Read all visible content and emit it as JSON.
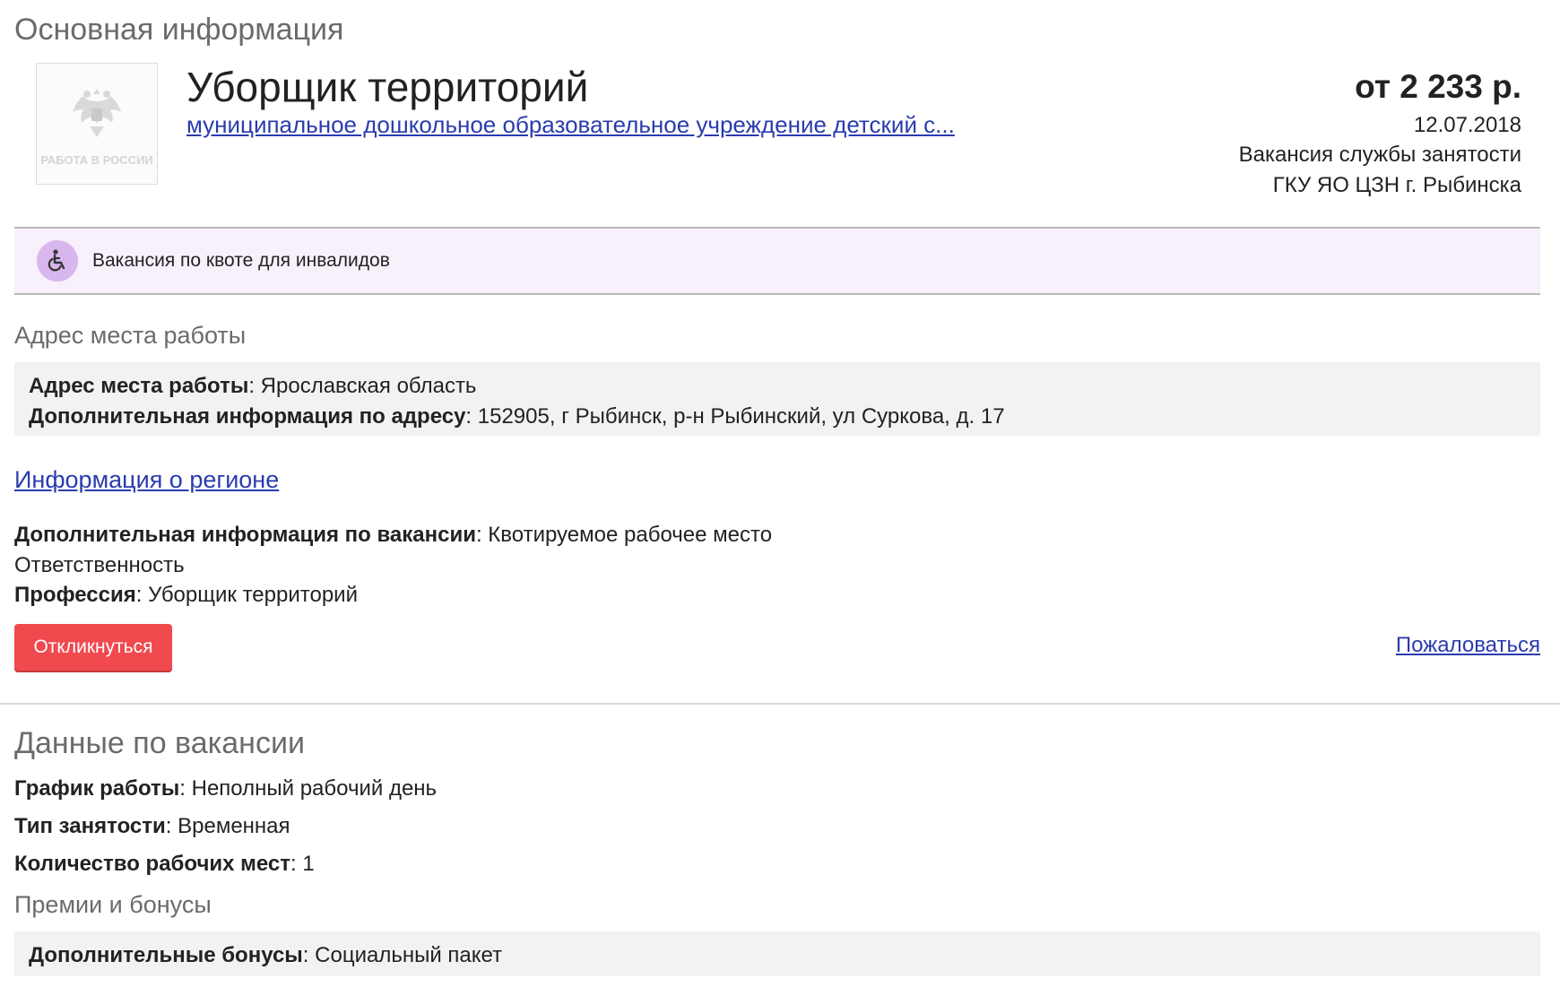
{
  "main_info": {
    "section_title": "Основная информация",
    "logo_text": "РАБОТА В РОССИИ",
    "job_title": "Уборщик территорий",
    "employer": "муниципальное дошкольное образовательное учреждение детский с...",
    "salary": "от 2 233 р.",
    "date": "12.07.2018",
    "vacancy_source": "Вакансия службы занятости",
    "agency": "ГКУ ЯО ЦЗН г. Рыбинска"
  },
  "quota": {
    "icon": "wheelchair-icon",
    "text": "Вакансия по квоте для инвалидов"
  },
  "address": {
    "section_title": "Адрес места работы",
    "work_address_label": "Адрес места работы",
    "work_address_value": "Ярославская область",
    "extra_label": "Дополнительная информация по адресу",
    "extra_value": "152905, г Рыбинск, р-н Рыбинский, ул Суркова, д. 17"
  },
  "region_link": "Информация о регионе",
  "vacancy_extra": {
    "label": "Дополнительная информация по вакансии",
    "value": "Квотируемое рабочее место",
    "line2": "Ответственность",
    "profession_label": "Профессия",
    "profession_value": "Уборщик территорий"
  },
  "actions": {
    "respond_label": "Откликнуться",
    "complain_label": "Пожаловаться"
  },
  "vacancy_data": {
    "section_title": "Данные по вакансии",
    "schedule_label": "График работы",
    "schedule_value": "Неполный рабочий день",
    "employment_label": "Тип занятости",
    "employment_value": "Временная",
    "places_label": "Количество рабочих мест",
    "places_value": "1"
  },
  "bonuses": {
    "section_title": "Премии и бонусы",
    "label": "Дополнительные бонусы",
    "value": "Социальный пакет"
  },
  "colors": {
    "link": "#2a3cae",
    "button": "#f0494e",
    "quota_bg": "#f8f0fb",
    "quota_icon_bg": "#d8b6ee"
  }
}
